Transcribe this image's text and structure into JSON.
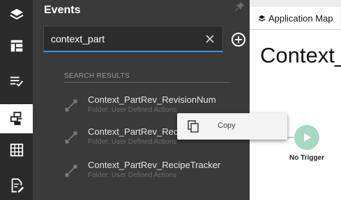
{
  "rail": {
    "items": [
      {
        "icon": "layers-icon"
      },
      {
        "icon": "layout-icon"
      },
      {
        "icon": "checklist-icon"
      },
      {
        "icon": "events-icon",
        "active": true
      },
      {
        "icon": "table-grid-icon"
      },
      {
        "icon": "document-edit-icon"
      }
    ]
  },
  "panel": {
    "title": "Events",
    "pin_icon": "pin-icon"
  },
  "search": {
    "value": "context_part",
    "clear_icon": "close-icon",
    "add_icon": "add-circle-icon"
  },
  "results": {
    "header": "SEARCH RESULTS",
    "items": [
      {
        "name": "Context_PartRev_RevisionNum",
        "folder": "Folder: User Defined Actions"
      },
      {
        "name": "Context_PartRev_Reci",
        "folder": "Folder: User Defined Actions"
      },
      {
        "name": "Context_PartRev_RecipeTracker",
        "folder": "Folder: User Defined Actions"
      }
    ]
  },
  "context_menu": {
    "items": [
      {
        "label": "Copy",
        "icon": "copy-icon"
      }
    ]
  },
  "canvas": {
    "tab_label": "Application Map",
    "title": "Context_",
    "trigger_label": "No Trigger"
  },
  "colors": {
    "accent": "#3f8fd8",
    "trigger": "#a6d9c0",
    "rail_bg": "#2b2b2b",
    "panel_bg": "#3a3a3a"
  }
}
